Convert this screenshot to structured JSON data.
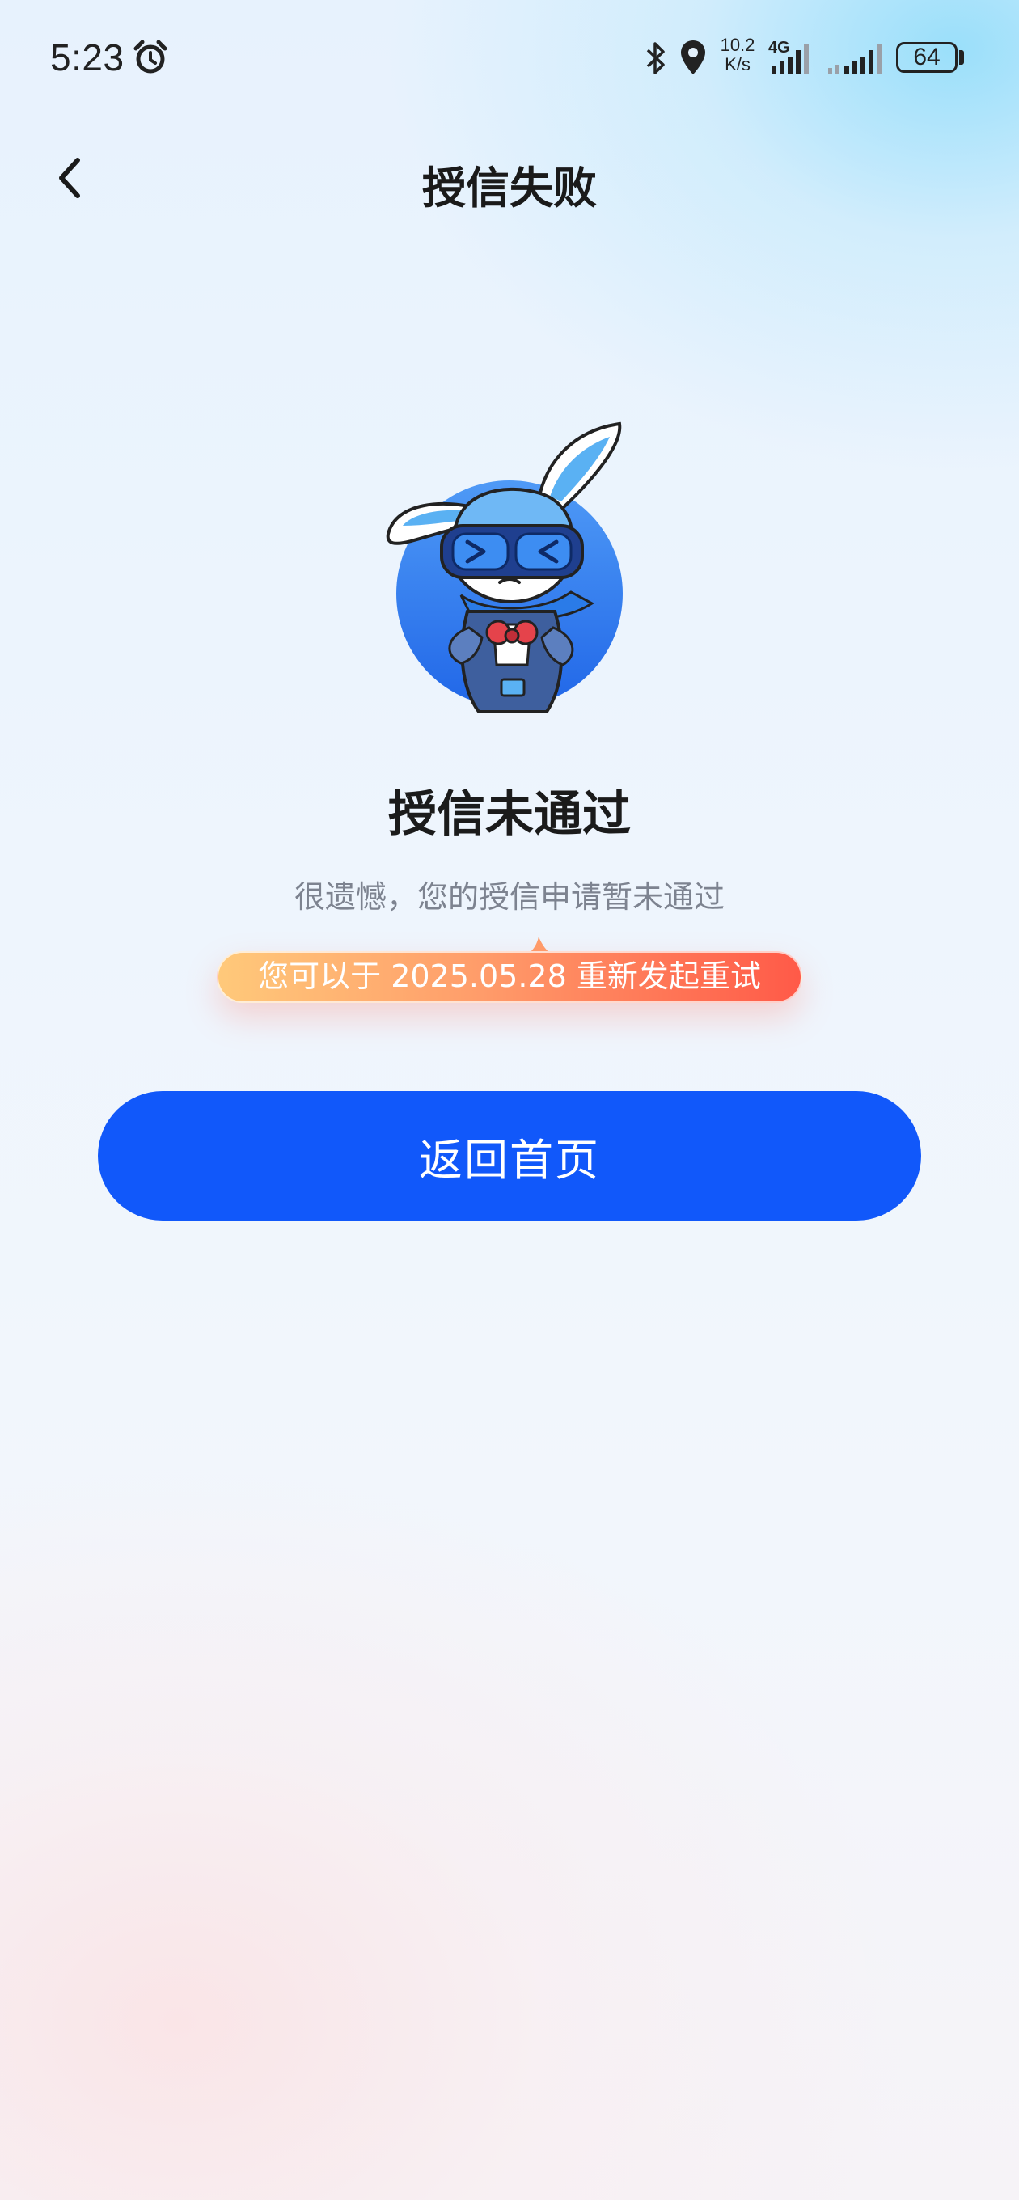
{
  "status_bar": {
    "time": "5:23",
    "net_speed_value": "10.2",
    "net_speed_unit": "K/s",
    "network_type": "4G",
    "battery": "64",
    "icons": [
      "alarm-icon",
      "bluetooth-icon",
      "location-icon",
      "signal-icon",
      "battery-icon"
    ]
  },
  "nav": {
    "title": "授信失败",
    "back_icon": "chevron-left-icon"
  },
  "result": {
    "illustration": "rabbit-mascot",
    "title": "授信未通过",
    "description": "很遗憾，您的授信申请暂未通过",
    "retry_tip": "您可以于 2025.05.28 重新发起重试"
  },
  "actions": {
    "home_button_label": "返回首页"
  },
  "colors": {
    "primary": "#1158fa",
    "tip_gradient_start": "#ffc97a",
    "tip_gradient_end": "#ff5a48"
  }
}
